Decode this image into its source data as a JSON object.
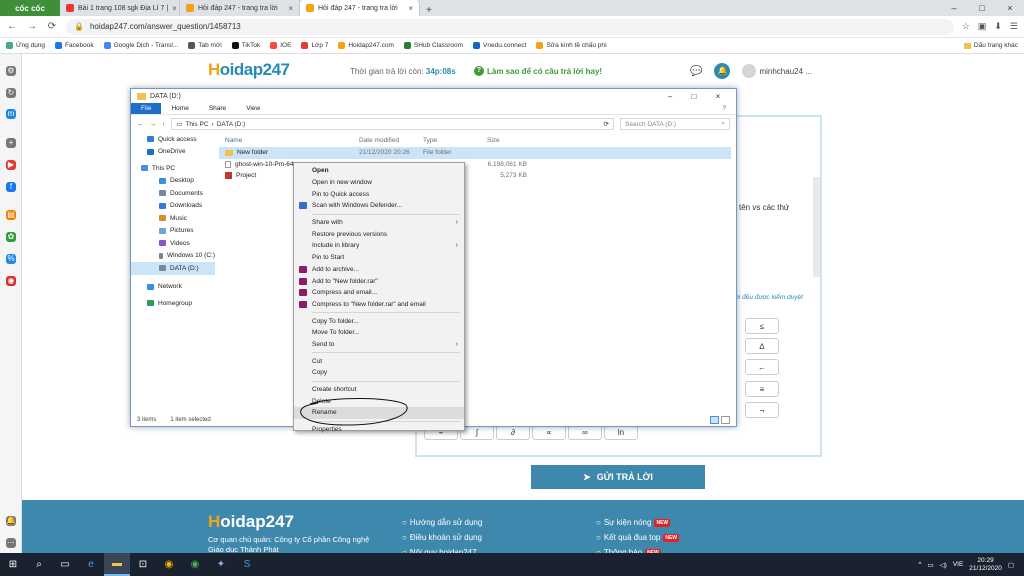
{
  "browser": {
    "brand": "cốc cốc",
    "tabs": [
      {
        "title": "Bài 1 trang 108 sgk Địa Lí 7 |",
        "color": "#e53935"
      },
      {
        "title": "Hỏi đáp 247 - trang tra lời",
        "color": "#f2a30f"
      },
      {
        "title": "Hỏi đáp 247 - trang tra lời",
        "color": "#f2a30f"
      }
    ],
    "url": "hoidap247.com/answer_question/1458713",
    "bookmarks": [
      "Ứng dụng",
      "Facebook",
      "Google Dịch - Transl...",
      "Tab mới",
      "TikTok",
      "IOE",
      "Lớp 7",
      "Hoidap247.com",
      "SHub Classroom",
      "Vnedu.connect",
      "Sửa kính tề chấu phí"
    ],
    "bookmark_colors": [
      "#4a8",
      "#1877f2",
      "#4285f4",
      "#555",
      "#111",
      "#f44",
      "#e53935",
      "#f2a30f",
      "#2e7d32",
      "#1565c0",
      "#f2a30f"
    ],
    "bookmarks_right": "Dấu trang khác"
  },
  "site": {
    "logo_main": "oidap247",
    "logo_h": "H",
    "logo_sub": ".com",
    "timer_label": "Thời gian trả lời còn:",
    "timer_value": "34p:08s",
    "help": "Làm sao để có câu trả lời hay!",
    "username": "minhchau24 ...",
    "partial_text": "tên vs các thứ",
    "partial_note": "ời đều được kiểm duyệt",
    "keyboard": [
      "≤",
      "∆",
      "←",
      "≡",
      "¬",
      "÷",
      "∫",
      "∂",
      "∝",
      "∞",
      "ln"
    ],
    "submit": "GỬI TRẢ LỜI",
    "footer": {
      "company": "Cơ quan chủ quản: Công ty Cổ phần Công nghệ",
      "company2": "Giáo dục Thành Phát",
      "col1": [
        "Hướng dẫn sử dụng",
        "Điều khoản sử dụng",
        "Nội quy hoidap247"
      ],
      "col2": [
        "Sự kiện nóng",
        "Kết quả đua top",
        "Thông báo"
      ],
      "new": "NEW"
    }
  },
  "explorer": {
    "title": "DATA (D:)",
    "ribbon": [
      "File",
      "Home",
      "Share",
      "View"
    ],
    "path": [
      "This PC",
      "DATA (D:)"
    ],
    "search": "Search DATA (D:)",
    "nav": [
      {
        "label": "Quick access",
        "color": "#2f7fd9"
      },
      {
        "label": "OneDrive",
        "color": "#1e6fc9"
      },
      {
        "label": "This PC",
        "color": "#4a90d9"
      },
      {
        "label": "Desktop",
        "color": "#3a8de0"
      },
      {
        "label": "Documents",
        "color": "#7a8796"
      },
      {
        "label": "Downloads",
        "color": "#2f7fd9"
      },
      {
        "label": "Music",
        "color": "#d98c2f"
      },
      {
        "label": "Pictures",
        "color": "#6aa6d9"
      },
      {
        "label": "Videos",
        "color": "#8855cc"
      },
      {
        "label": "Windows 10 (C:)",
        "color": "#7a8796"
      },
      {
        "label": "DATA (D:)",
        "color": "#7a8796"
      },
      {
        "label": "Network",
        "color": "#3a8de0"
      },
      {
        "label": "Homegroup",
        "color": "#2f9a5a"
      }
    ],
    "columns": [
      "Name",
      "Date modified",
      "Type",
      "Size"
    ],
    "files": [
      {
        "name": "New folder",
        "date": "21/12/2020 20:26",
        "type": "File folder",
        "size": ""
      },
      {
        "name": "ghost-win-10-Pm-64...",
        "date": "",
        "type": "",
        "size": "6,198,061 KB"
      },
      {
        "name": "Project",
        "date": "",
        "type": "ieeP...",
        "size": "5,273 KB"
      }
    ],
    "status_items": "3 items",
    "status_selected": "1 item selected"
  },
  "context_menu": [
    {
      "label": "Open",
      "bold": true
    },
    {
      "label": "Open in new window"
    },
    {
      "label": "Pin to Quick access"
    },
    {
      "label": "Scan with Windows Defender...",
      "icon": "#2e6fd0"
    },
    {
      "sep": true
    },
    {
      "label": "Share with",
      "arrow": true
    },
    {
      "label": "Restore previous versions"
    },
    {
      "label": "Include in library",
      "arrow": true
    },
    {
      "label": "Pin to Start"
    },
    {
      "label": "Add to archive...",
      "icon": "#8b1b6b"
    },
    {
      "label": "Add to \"New folder.rar\"",
      "icon": "#8b1b6b"
    },
    {
      "label": "Compress and email...",
      "icon": "#8b1b6b"
    },
    {
      "label": "Compress to \"New folder.rar\" and email",
      "icon": "#8b1b6b"
    },
    {
      "sep": true
    },
    {
      "label": "Copy To folder..."
    },
    {
      "label": "Move To folder..."
    },
    {
      "label": "Send to",
      "arrow": true
    },
    {
      "sep": true
    },
    {
      "label": "Cut"
    },
    {
      "label": "Copy"
    },
    {
      "sep": true
    },
    {
      "label": "Create shortcut"
    },
    {
      "label": "Delete"
    },
    {
      "label": "Rename",
      "highlight": true
    },
    {
      "sep": true
    },
    {
      "label": "Properties"
    }
  ],
  "taskbar": {
    "lang": "VIE",
    "time": "20:29",
    "date": "21/12/2020"
  }
}
